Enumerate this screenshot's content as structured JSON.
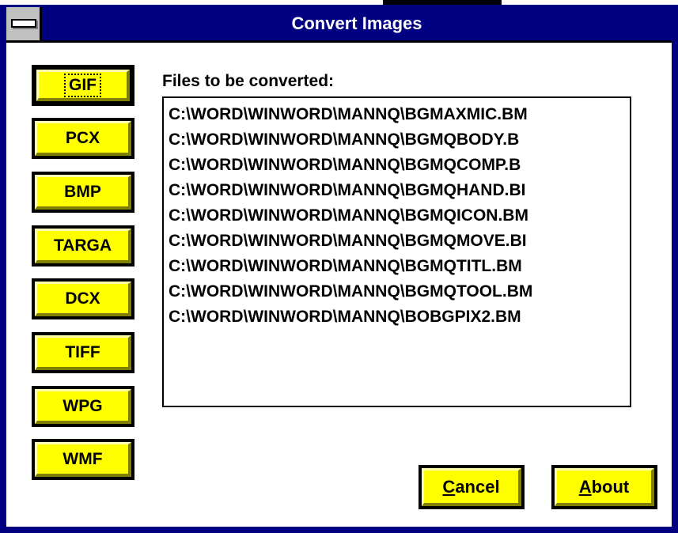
{
  "window": {
    "title": "Convert Images"
  },
  "formats": [
    {
      "label": "GIF"
    },
    {
      "label": "PCX"
    },
    {
      "label": "BMP"
    },
    {
      "label": "TARGA"
    },
    {
      "label": "DCX"
    },
    {
      "label": "TIFF"
    },
    {
      "label": "WPG"
    },
    {
      "label": "WMF"
    }
  ],
  "files": {
    "label": "Files to be converted:",
    "items": [
      "C:\\WORD\\WINWORD\\MANNQ\\BGMAXMIC.BM",
      "C:\\WORD\\WINWORD\\MANNQ\\BGMQBODY.B",
      "C:\\WORD\\WINWORD\\MANNQ\\BGMQCOMP.B",
      "C:\\WORD\\WINWORD\\MANNQ\\BGMQHAND.BI",
      "C:\\WORD\\WINWORD\\MANNQ\\BGMQICON.BM",
      "C:\\WORD\\WINWORD\\MANNQ\\BGMQMOVE.BI",
      "C:\\WORD\\WINWORD\\MANNQ\\BGMQTITL.BM",
      "C:\\WORD\\WINWORD\\MANNQ\\BGMQTOOL.BM",
      "C:\\WORD\\WINWORD\\MANNQ\\BOBGPIX2.BM"
    ]
  },
  "buttons": {
    "cancel": {
      "mnemonic": "C",
      "rest": "ancel"
    },
    "about": {
      "mnemonic": "A",
      "rest": "bout"
    }
  },
  "icons": {
    "system_menu": "system-menu-icon"
  },
  "colors": {
    "titlebar": "#000080",
    "button_face": "#ffff00",
    "window_bg": "#ffffff"
  }
}
